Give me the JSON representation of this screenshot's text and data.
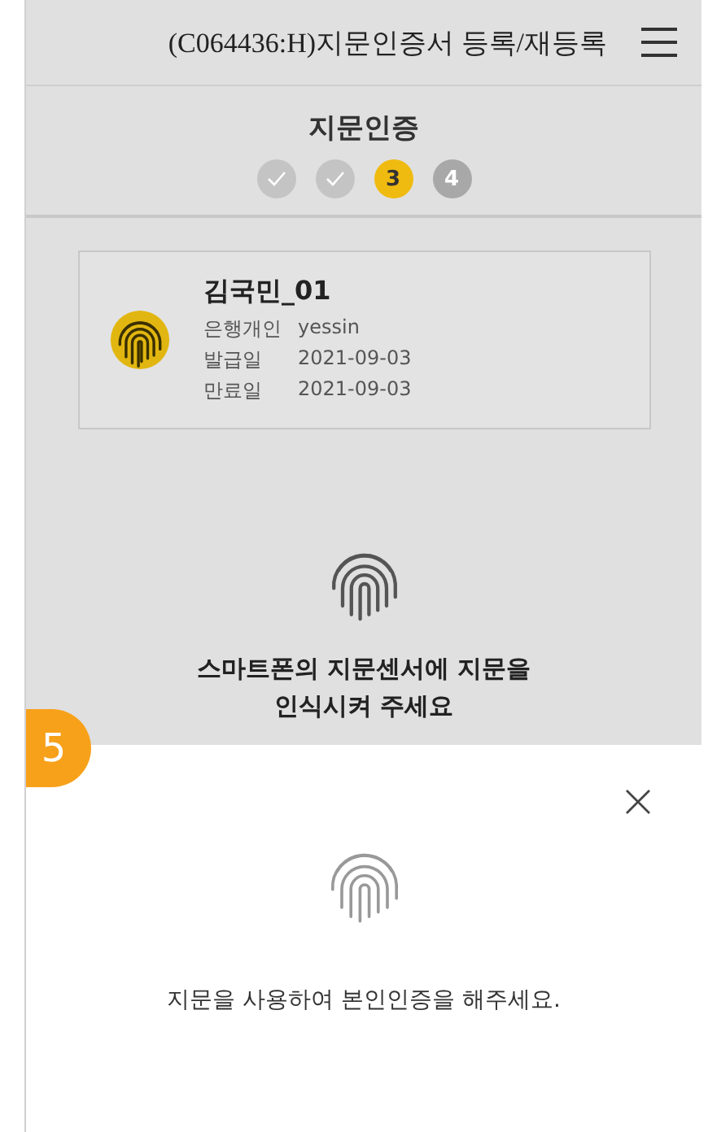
{
  "header": {
    "title": "(C064436:H)지문인증서 등록/재등록"
  },
  "page": {
    "title": "지문인증",
    "steps": [
      {
        "done": true,
        "selected": false
      },
      {
        "done": true,
        "selected": false
      },
      {
        "done": false,
        "selected": true,
        "label": "3"
      },
      {
        "done": false,
        "selected": false,
        "label": "4"
      }
    ]
  },
  "certificate": {
    "name": "김국민_01",
    "fields": [
      {
        "label": "은행개인",
        "value": "yessin"
      },
      {
        "label": "발급일",
        "value": "2021-09-03"
      },
      {
        "label": "만료일",
        "value": "2021-09-03"
      }
    ]
  },
  "instruction": [
    "스마트폰의 지문센서에 지문을",
    "인식시켜 주세요"
  ],
  "dialog": {
    "message": "지문을 사용하여 본인인증을 해주세요."
  },
  "badge": {
    "label": "5"
  }
}
